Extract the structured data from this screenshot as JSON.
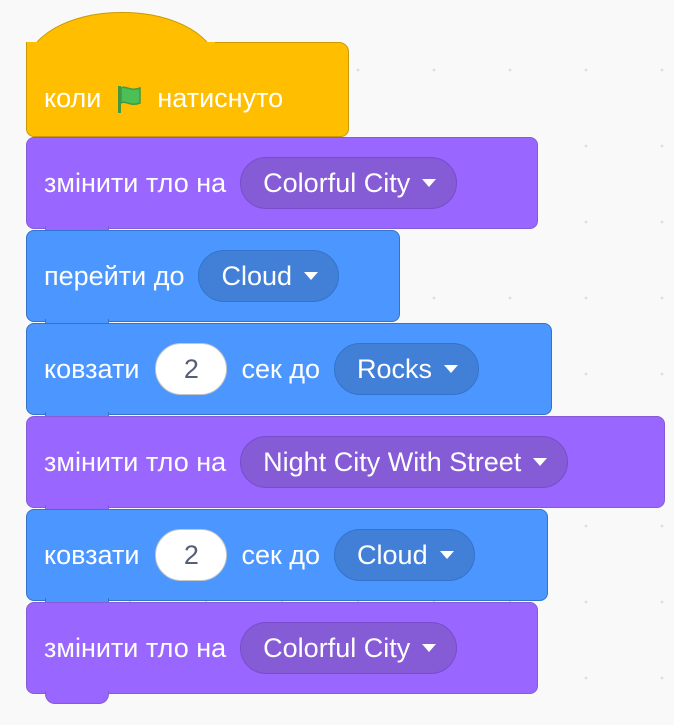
{
  "script": {
    "hat": {
      "when_text": "коли",
      "clicked_text": "натиснуто",
      "icon": "green-flag-icon"
    },
    "blocks": [
      {
        "kind": "looks",
        "label": "змінити тло на",
        "dropdown": "Colorful City"
      },
      {
        "kind": "motion",
        "label": "перейти до",
        "dropdown": "Cloud"
      },
      {
        "kind": "motion",
        "label": "ковзати",
        "number": "2",
        "label2": "сек до",
        "dropdown": "Rocks"
      },
      {
        "kind": "looks",
        "label": "змінити тло на",
        "dropdown": "Night City With Street"
      },
      {
        "kind": "motion",
        "label": "ковзати",
        "number": "2",
        "label2": "сек до",
        "dropdown": "Cloud"
      },
      {
        "kind": "looks",
        "label": "змінити тло на",
        "dropdown": "Colorful City"
      }
    ]
  },
  "colors": {
    "events": "#ffbf00",
    "looks": "#9966ff",
    "motion": "#4c97ff",
    "flag": "#4cbf56"
  }
}
